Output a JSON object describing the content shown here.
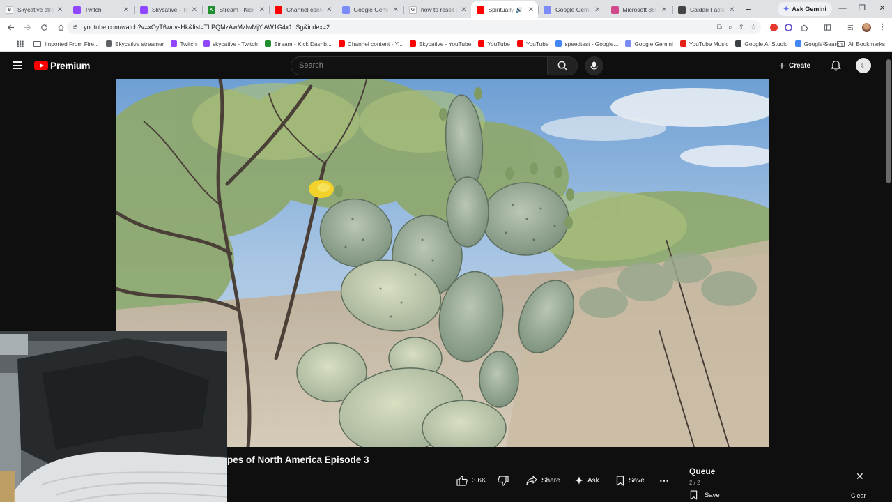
{
  "browser": {
    "tabs": [
      {
        "title": "Skycative streamer",
        "favicon_color": "#ffffff",
        "favicon_glyph": "☯",
        "active": false
      },
      {
        "title": "Twitch",
        "favicon_color": "#9146ff",
        "favicon_glyph": "",
        "active": false
      },
      {
        "title": "Skycative - Twitch",
        "favicon_color": "#9146ff",
        "favicon_glyph": "",
        "active": false
      },
      {
        "title": "Stream - Kick Dashboard",
        "favicon_color": "#1f8f2f",
        "favicon_glyph": "K",
        "active": false
      },
      {
        "title": "Channel content - YouTube",
        "favicon_color": "#ff0000",
        "favicon_glyph": "",
        "active": false
      },
      {
        "title": "Google Gemini",
        "favicon_color": "#7b8cf8",
        "favicon_glyph": "",
        "active": false
      },
      {
        "title": "how to resell products",
        "favicon_color": "#ffffff",
        "favicon_glyph": "G",
        "active": false
      },
      {
        "title": "Spiritually Sound",
        "favicon_color": "#ff0000",
        "favicon_glyph": "",
        "active": true,
        "audio": true
      },
      {
        "title": "Google Gemini",
        "favicon_color": "#7b8cf8",
        "favicon_glyph": "",
        "active": false
      },
      {
        "title": "Microsoft 365",
        "favicon_color": "#d04a8a",
        "favicon_glyph": "",
        "active": false
      },
      {
        "title": "Caldari Faction",
        "favicon_color": "#444444",
        "favicon_glyph": "",
        "active": false
      }
    ],
    "new_tab_glyph": "+",
    "ask_gemini_label": "Ask Gemini",
    "url": "youtube.com/watch?v=xOyT6wuvsHk&list=TLPQMzAwMzIwMjYiAW1G4x1hSg&index=2",
    "bookmarks": [
      {
        "label": "Imported From Fire...",
        "type": "folder",
        "color": "#5f6368"
      },
      {
        "label": "Skycative streamer",
        "type": "site",
        "color": "#5f6368"
      },
      {
        "label": "Twitch",
        "type": "site",
        "color": "#9146ff"
      },
      {
        "label": "skycative - Twitch",
        "type": "site",
        "color": "#9146ff"
      },
      {
        "label": "Stream - Kick Dashb...",
        "type": "site",
        "color": "#1f8f2f"
      },
      {
        "label": "Channel content - Y...",
        "type": "site",
        "color": "#ff0000"
      },
      {
        "label": "Skycative - YouTube",
        "type": "site",
        "color": "#ff0000"
      },
      {
        "label": "YouTube",
        "type": "site",
        "color": "#ff0000"
      },
      {
        "label": "YouTube",
        "type": "site",
        "color": "#ff0000"
      },
      {
        "label": "speedtest - Google...",
        "type": "site",
        "color": "#4285f4"
      },
      {
        "label": "Google Gemini",
        "type": "site",
        "color": "#7b8cf8"
      },
      {
        "label": "YouTube Music",
        "type": "site",
        "color": "#e62117"
      },
      {
        "label": "Google AI Studio",
        "type": "site",
        "color": "#3c4043"
      },
      {
        "label": "Google Search",
        "type": "site",
        "color": "#4285f4"
      }
    ],
    "overflow_glyph": "»",
    "all_bookmarks_label": "All Bookmarks"
  },
  "youtube": {
    "logo_word": "Premium",
    "search_placeholder": "Search",
    "create_label": "Create",
    "create_plus": "+",
    "avatar_glyph": "☾",
    "video_title": "pes of North America Episode 3",
    "actions": {
      "like_count": "3.6K",
      "share_label": "Share",
      "ask_label": "Ask",
      "save_label": "Save",
      "more_glyph": "⋯"
    },
    "queue": {
      "title": "Queue",
      "count": "2 / 2",
      "save_label": "Save",
      "clear_label": "Clear",
      "close_glyph": "✕"
    }
  },
  "colors": {
    "yt_background": "#0f0f0f",
    "yt_red": "#ff0000",
    "chrome_tabstrip": "#dfe1e5"
  }
}
